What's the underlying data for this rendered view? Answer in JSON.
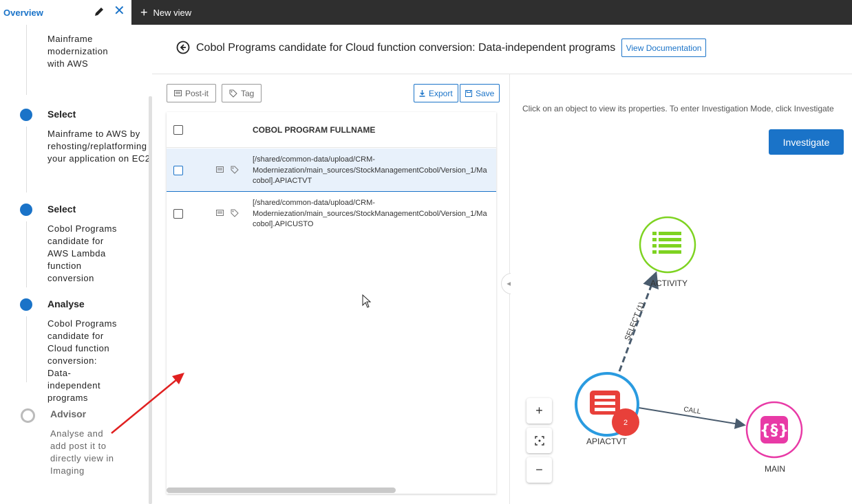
{
  "topbar": {
    "overview_tab": "Overview",
    "new_view": "New view"
  },
  "sidebar": {
    "steps": [
      {
        "title": "",
        "desc": "Mainframe\nmodernization\nwith AWS"
      },
      {
        "title": "Select",
        "desc": "Mainframe to AWS by\nrehosting/replatforming\nyour application on EC2"
      },
      {
        "title": "Select",
        "desc": "Cobol Programs\ncandidate for\nAWS Lambda\nfunction\nconversion"
      },
      {
        "title": "Analyse",
        "desc": "Cobol Programs\ncandidate for\nCloud function\nconversion:\nData-\nindependent\nprograms"
      },
      {
        "title": "Advisor",
        "desc": "Analyse and\nadd post it to\ndirectly view in\nImaging"
      }
    ]
  },
  "header": {
    "title": "Cobol Programs candidate for Cloud function conversion: Data-independent programs",
    "doc_button": "View Documentation"
  },
  "toolbar": {
    "postit": "Post-it",
    "tag": "Tag",
    "export": "Export",
    "save": "Save"
  },
  "table": {
    "column": "COBOL PROGRAM FULLNAME",
    "rows": [
      {
        "path": "[/shared/common-data/upload/CRM-\nModerniezation/main_sources/StockManagementCobol/Version_1/Ma\ncobol].APIACTVT"
      },
      {
        "path": "[/shared/common-data/upload/CRM-\nModerniezation/main_sources/StockManagementCobol/Version_1/Ma\ncobol].APICUSTO"
      }
    ]
  },
  "graph": {
    "hint": "Click on an object to view its properties. To enter Investigation Mode, click Investigate",
    "investigate": "Investigate",
    "nodes": {
      "activity": "ACTIVITY",
      "apiactvt": "APIACTVT",
      "main": "MAIN"
    },
    "edges": {
      "select": "SELECT (1)",
      "call": "CALL"
    },
    "badge": "2",
    "zoom_in": "+",
    "zoom_out": "−",
    "colors": {
      "activity": "#7ed321",
      "apiactvt_ring": "#2a9be0",
      "apiactvt_icon": "#e8403a",
      "main": "#e83aa6"
    }
  }
}
